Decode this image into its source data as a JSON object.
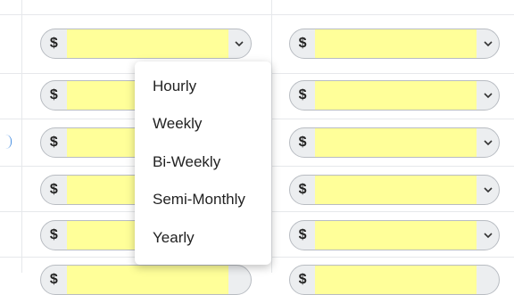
{
  "currency_symbol": "$",
  "amount_placeholder": "",
  "input_highlight_color": "#ffff99",
  "toggle_icon": "chevron-down-icon",
  "pay_frequency_menu": {
    "items": [
      "Hourly",
      "Weekly",
      "Bi-Weekly",
      "Semi-Monthly",
      "Yearly"
    ]
  }
}
